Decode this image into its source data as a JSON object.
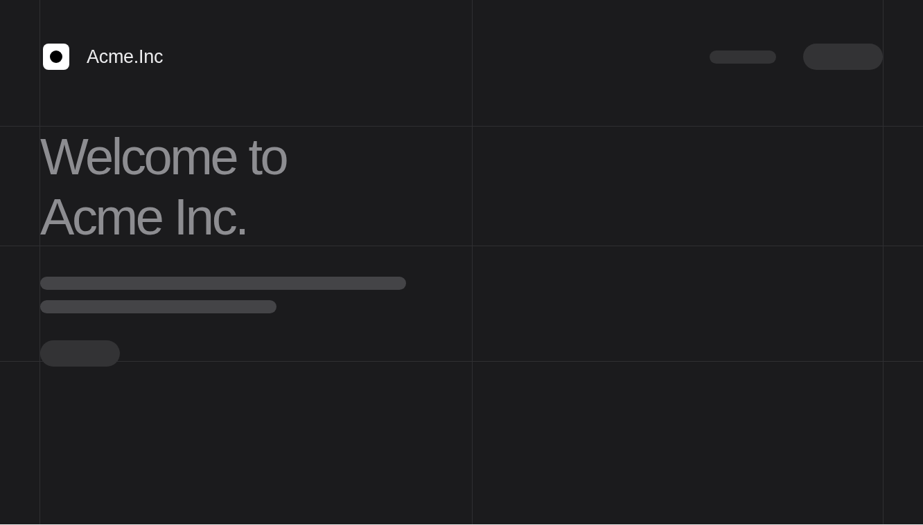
{
  "header": {
    "brand": "Acme.Inc",
    "nav": [
      {
        "kind": "link-placeholder"
      },
      {
        "kind": "button-placeholder"
      }
    ]
  },
  "hero": {
    "title": "Welcome to\nAcme Inc.",
    "placeholders": [
      {
        "kind": "text-line-long"
      },
      {
        "kind": "text-line-short"
      },
      {
        "kind": "button-placeholder"
      }
    ]
  }
}
